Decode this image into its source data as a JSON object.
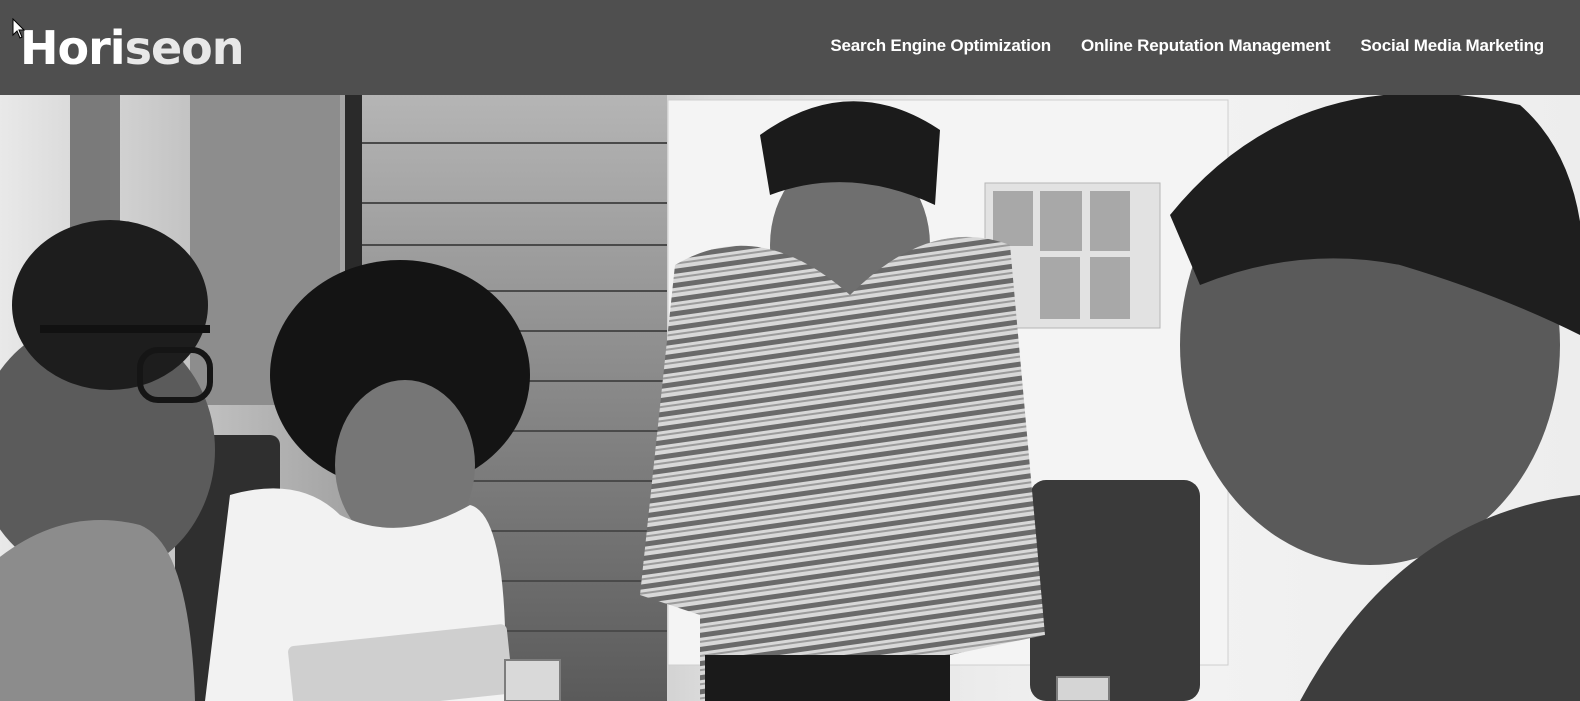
{
  "header": {
    "logo_main": "Hori",
    "logo_accent": "seon",
    "nav": [
      "Search Engine Optimization",
      "Online Reputation Management",
      "Social Media Marketing"
    ]
  },
  "hero": {
    "image": "black-and-white photo of four people collaborating around a laptop"
  },
  "colors": {
    "header_bg": "#4f4f4f",
    "nav_text": "#ffffff"
  }
}
